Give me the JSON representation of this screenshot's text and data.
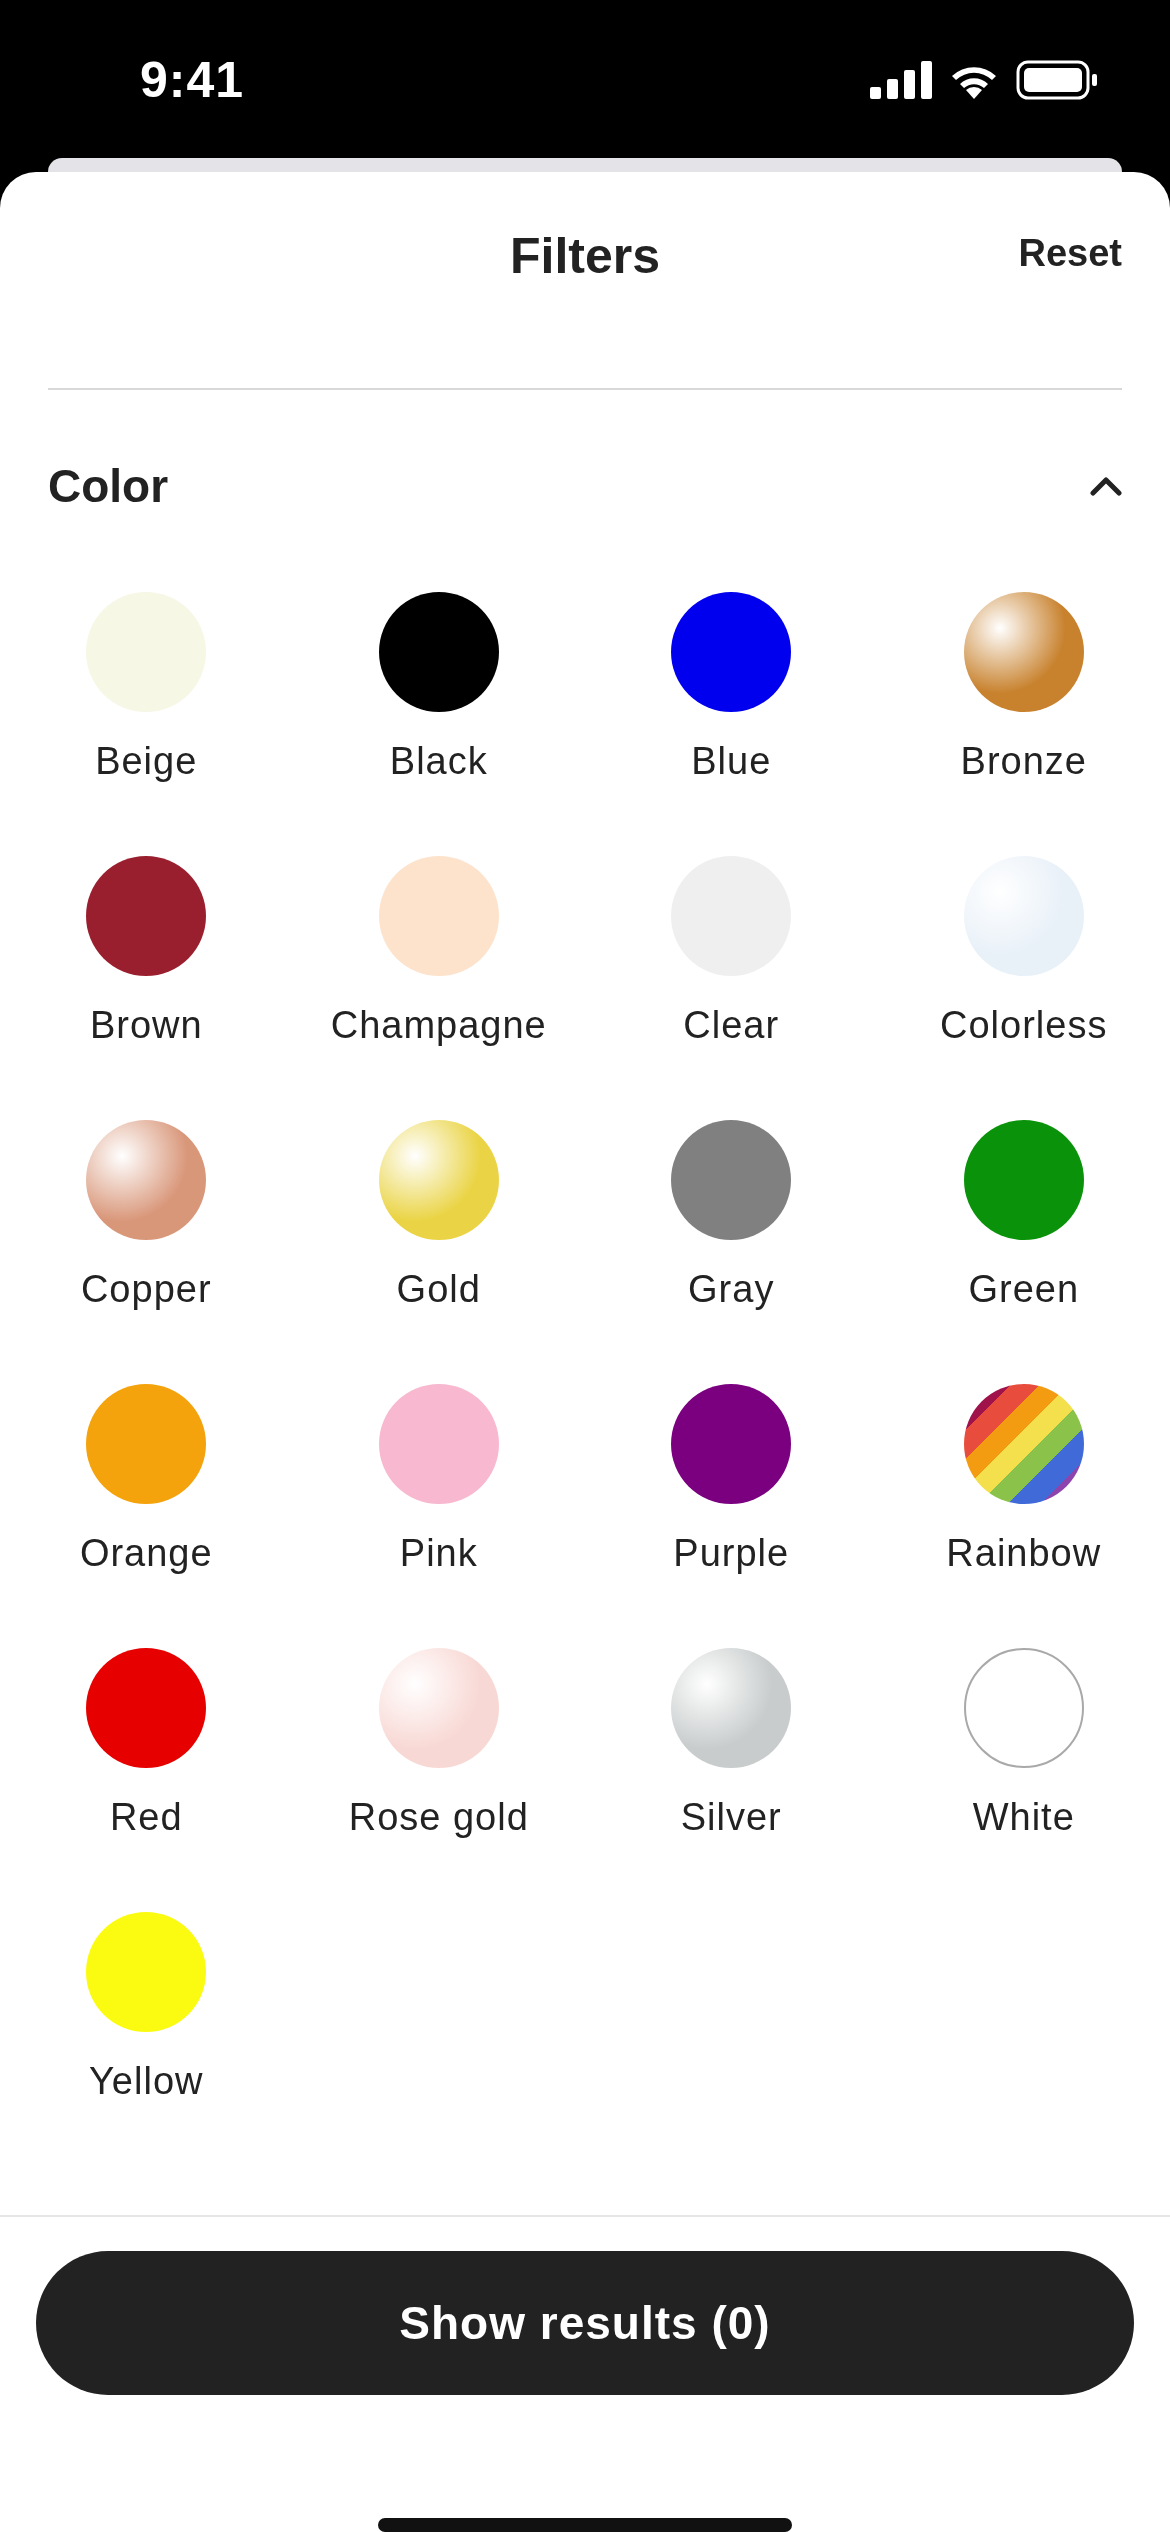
{
  "status_bar": {
    "time": "9:41"
  },
  "header": {
    "title": "Filters",
    "reset": "Reset"
  },
  "section": {
    "title": "Color",
    "expanded": true
  },
  "colors": [
    {
      "label": "Beige",
      "color": "#f7f7e6",
      "kind": "solid",
      "selected": false
    },
    {
      "label": "Black",
      "color": "#000000",
      "kind": "solid",
      "selected": false
    },
    {
      "label": "Blue",
      "color": "#0000ee",
      "kind": "solid",
      "selected": false
    },
    {
      "label": "Bronze",
      "color": "#c8822e",
      "kind": "gradient",
      "selected": false
    },
    {
      "label": "Brown",
      "color": "#9a1f2e",
      "kind": "solid",
      "selected": false
    },
    {
      "label": "Champagne",
      "color": "#fde3cc",
      "kind": "solid",
      "selected": false
    },
    {
      "label": "Clear",
      "color": "#efefef",
      "kind": "solid",
      "selected": false
    },
    {
      "label": "Colorless",
      "color": "#e8f0f8",
      "kind": "gradient",
      "selected": false
    },
    {
      "label": "Copper",
      "color": "#d9977a",
      "kind": "gradient",
      "selected": false
    },
    {
      "label": "Gold",
      "color": "#ead445",
      "kind": "gradient",
      "selected": false
    },
    {
      "label": "Gray",
      "color": "#808080",
      "kind": "solid",
      "selected": false
    },
    {
      "label": "Green",
      "color": "#0a930a",
      "kind": "solid",
      "selected": false
    },
    {
      "label": "Orange",
      "color": "#f4a30c",
      "kind": "solid",
      "selected": false
    },
    {
      "label": "Pink",
      "color": "#f8b8cf",
      "kind": "solid",
      "selected": false
    },
    {
      "label": "Purple",
      "color": "#7a0080",
      "kind": "solid",
      "selected": false
    },
    {
      "label": "Rainbow",
      "kind": "rainbow",
      "selected": false
    },
    {
      "label": "Red",
      "color": "#e60000",
      "kind": "solid",
      "selected": false
    },
    {
      "label": "Rose gold",
      "color": "#f8d8d4",
      "kind": "gradient",
      "selected": false
    },
    {
      "label": "Silver",
      "color": "#c8cccc",
      "kind": "gradient",
      "selected": false
    },
    {
      "label": "White",
      "color": "#ffffff",
      "kind": "outline",
      "selected": false
    },
    {
      "label": "Yellow",
      "color": "#fbfb12",
      "kind": "solid",
      "selected": false
    }
  ],
  "footer": {
    "button": "Show results (0)"
  }
}
